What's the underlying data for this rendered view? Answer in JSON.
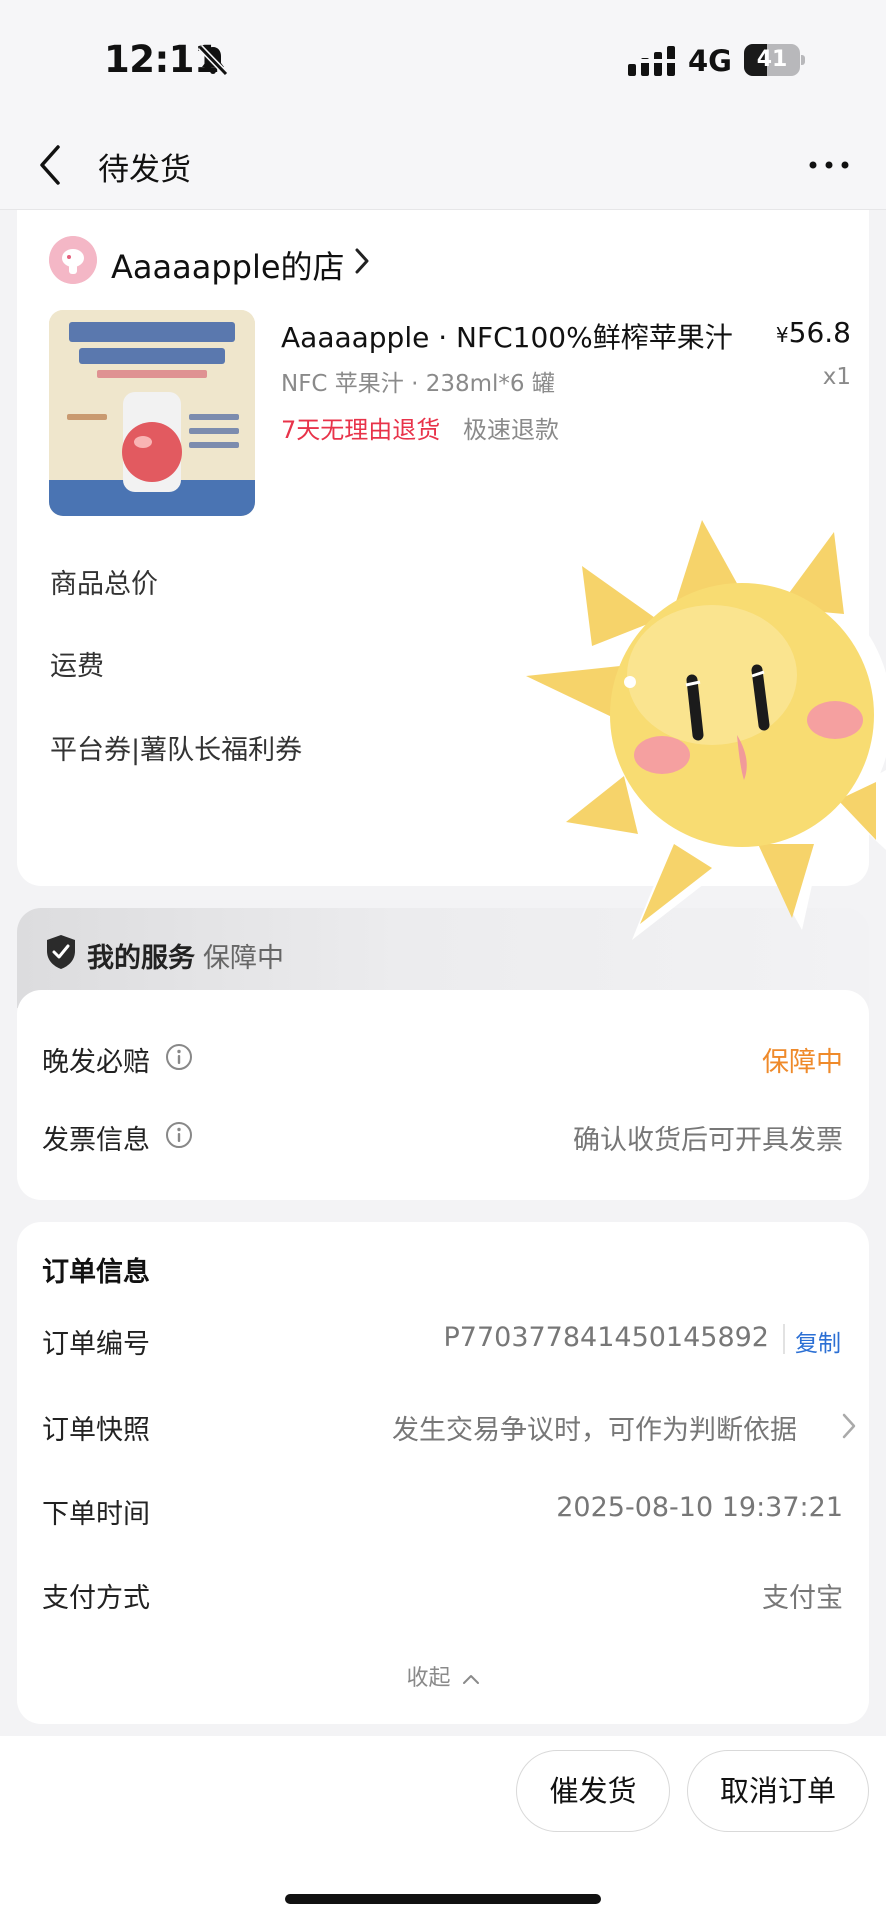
{
  "status_bar": {
    "time": "12:11",
    "network": "4G",
    "battery": "41",
    "battery_level": 0.41
  },
  "nav": {
    "title": "待发货"
  },
  "store": {
    "name": "Aaaaapple的店",
    "product": {
      "title": "Aaaaapple · NFC100%鲜榨苹果汁",
      "price_symbol": "¥",
      "price": "56.8",
      "spec": "NFC 苹果汁 · 238ml*6 罐",
      "qty": "x1",
      "refund_tag": "7天无理由退货",
      "fast_refund": "极速退款"
    },
    "fees": {
      "total_label": "商品总价",
      "shipping_label": "运费",
      "coupon_label": "平台券|薯队长福利券"
    }
  },
  "service": {
    "title": "我的服务",
    "title_status": "保障中",
    "rows": [
      {
        "label": "晚发必赔",
        "value": "保障中"
      },
      {
        "label": "发票信息",
        "value": "确认收货后可开具发票"
      }
    ]
  },
  "order": {
    "title": "订单信息",
    "number_label": "订单编号",
    "number_value": "P770377841450145892",
    "copy_label": "复制",
    "snapshot_label": "订单快照",
    "snapshot_value": "发生交易争议时，可作为判断依据",
    "time_label": "下单时间",
    "time_value": "2025-08-10 19:37:21",
    "payment_label": "支付方式",
    "payment_value": "支付宝",
    "collapse_label": "收起"
  },
  "actions": {
    "urge_label": "催发货",
    "cancel_label": "取消订单"
  },
  "colors": {
    "accent_red": "#e8334a",
    "accent_orange": "#ef8a2a",
    "link_blue": "#2b6fd4"
  },
  "icons": [
    "mute-icon",
    "signal-icon",
    "battery-icon",
    "back-icon",
    "more-icon",
    "chevron-right-icon",
    "shield-icon",
    "info-icon",
    "chevron-up-icon"
  ]
}
